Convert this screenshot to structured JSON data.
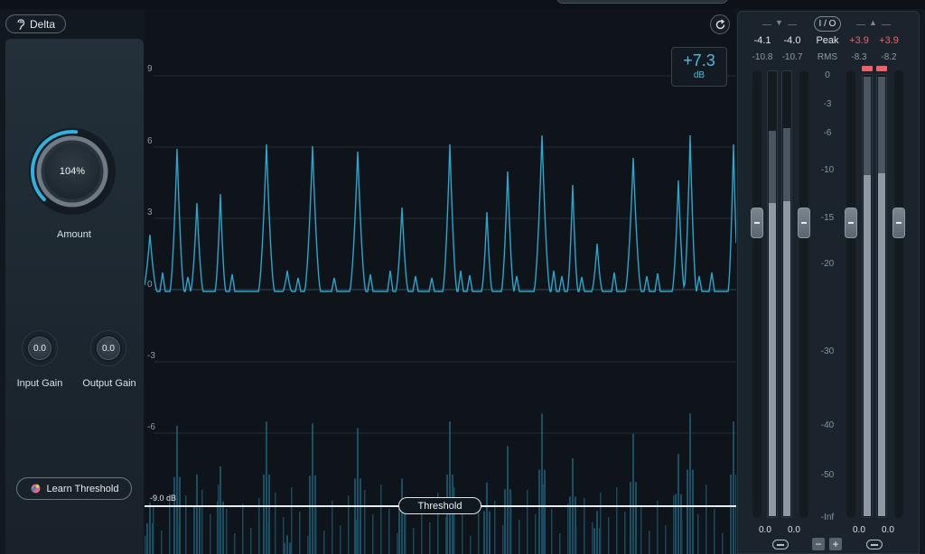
{
  "delta": {
    "label": "Delta"
  },
  "amount": {
    "value": "104%",
    "label": "Amount",
    "fraction": 0.52
  },
  "input_gain": {
    "value": "0.0",
    "label": "Input Gain"
  },
  "output_gain": {
    "value": "0.0",
    "label": "Output Gain"
  },
  "learn_threshold": {
    "label": "Learn Threshold"
  },
  "graph": {
    "y_labels": [
      "9",
      "6",
      "3",
      "0",
      "-3",
      "-6"
    ],
    "gain_readout": {
      "value": "+7.3",
      "unit": "dB"
    },
    "threshold": {
      "label": "Threshold",
      "value_label": "-9.0 dB"
    },
    "accent": "#2aa6cf"
  },
  "meters": {
    "io_label": "I / O",
    "peak_label": "Peak",
    "rms_label": "RMS",
    "input_peak": [
      "-4.1",
      "-4.0"
    ],
    "input_rms": [
      "-10.8",
      "-10.7"
    ],
    "output_peak": [
      "+3.9",
      "+3.9"
    ],
    "output_rms": [
      "-8.3",
      "-8.2"
    ],
    "scale": [
      "0",
      "-3",
      "-6",
      "-10",
      "-15",
      "-20",
      "-30",
      "-40",
      "-50",
      "-Inf"
    ],
    "input_fader": [
      "0.0",
      "0.0"
    ],
    "output_fader": [
      "0.0",
      "0.0"
    ],
    "clip_color": "#f26068",
    "peak_color": "#f26068",
    "link_icon": "link-icon",
    "minus_label": "−",
    "plus_label": "+"
  }
}
